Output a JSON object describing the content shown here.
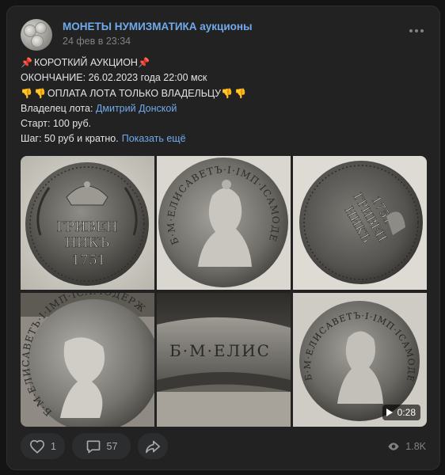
{
  "post": {
    "group_name": "МОНЕТЫ НУМИЗМАТИКА аукционы",
    "timestamp": "24 фев в 23:34",
    "lines": {
      "title": "КОРОТКИЙ АУКЦИОН",
      "ending": "ОКОНЧАНИЕ: 26.02.2023 года 22:00 мск",
      "payment": "ОПЛАТА ЛОТА ТОЛЬКО ВЛАДЕЛЬЦУ",
      "owner_label": "Владелец лота:",
      "owner_name": "Дмитрий Донской",
      "start": "Старт: 100 руб.",
      "step": "Шаг: 50 руб и кратно."
    },
    "show_more": "Показать ещё",
    "icons": {
      "pin": "pushpin-icon",
      "thumb": "thumbs-down-icon"
    }
  },
  "gallery": {
    "coin_texts": {
      "reverse_line1": "ГРИВЕН",
      "reverse_line2": "НИКЪ",
      "reverse_year": "1751",
      "obverse_legend": "Б·М·ЕЛИСАВЕТЪ·I·IМП·IСАМОДЕРЖ·ВСЕРОС",
      "edge_legend": "Б·М·ЕЛИС"
    },
    "video_duration": "0:28"
  },
  "footer": {
    "likes": "1",
    "comments": "57",
    "views": "1.8K"
  },
  "colors": {
    "accent": "#71aaeb",
    "card_bg": "#222222",
    "page_bg": "#141414",
    "button_bg": "#2c2d2e",
    "muted": "#828282"
  }
}
